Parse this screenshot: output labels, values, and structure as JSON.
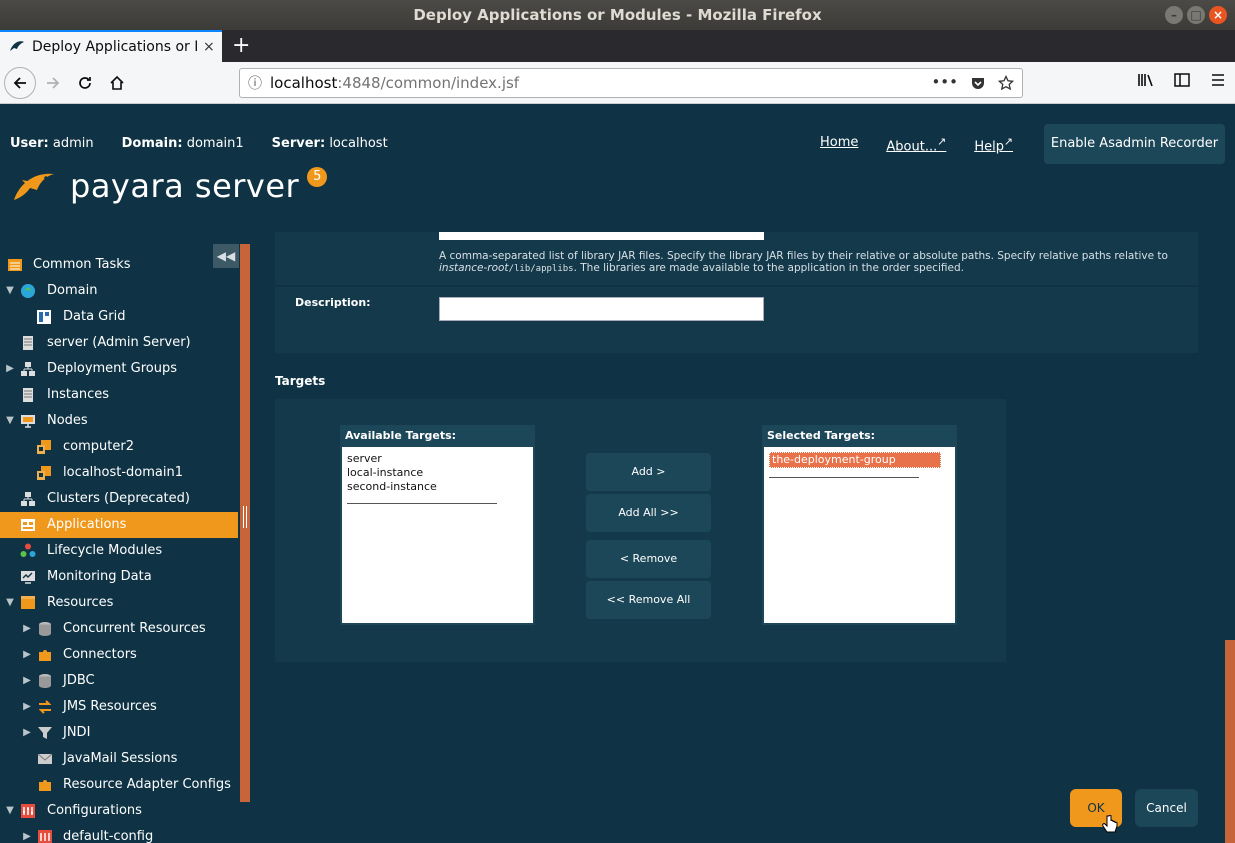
{
  "window": {
    "title": "Deploy Applications or Modules - Mozilla Firefox",
    "controls": [
      "–",
      "□",
      "×"
    ]
  },
  "browser": {
    "tab_title": "Deploy Applications or Modules",
    "tab_close": "×",
    "new_tab": "+",
    "url_host": "localhost",
    "url_rest": ":4848/common/index.jsf",
    "page_actions": "•••"
  },
  "header": {
    "user_label": "User:",
    "user_value": "admin",
    "domain_label": "Domain:",
    "domain_value": "domain1",
    "server_label": "Server:",
    "server_value": "localhost",
    "links": {
      "home": "Home",
      "about": "About...",
      "help": "Help"
    },
    "asadmin_button": "Enable Asadmin Recorder",
    "logo_text": "payara server",
    "logo_version": "5"
  },
  "sidebar": {
    "collapse_icon": "◀◀",
    "items": [
      {
        "label": "Common Tasks"
      },
      {
        "label": "Domain"
      },
      {
        "label": "Data Grid"
      },
      {
        "label": "server (Admin Server)"
      },
      {
        "label": "Deployment Groups"
      },
      {
        "label": "Instances"
      },
      {
        "label": "Nodes"
      },
      {
        "label": "computer2"
      },
      {
        "label": "localhost-domain1"
      },
      {
        "label": "Clusters (Deprecated)"
      },
      {
        "label": "Applications"
      },
      {
        "label": "Lifecycle Modules"
      },
      {
        "label": "Monitoring Data"
      },
      {
        "label": "Resources"
      },
      {
        "label": "Concurrent Resources"
      },
      {
        "label": "Connectors"
      },
      {
        "label": "JDBC"
      },
      {
        "label": "JMS Resources"
      },
      {
        "label": "JNDI"
      },
      {
        "label": "JavaMail Sessions"
      },
      {
        "label": "Resource Adapter Configs"
      },
      {
        "label": "Configurations"
      },
      {
        "label": "default-config"
      }
    ],
    "active_item": "Applications"
  },
  "form": {
    "libraries_help_1": "A comma-separated list of library JAR files. Specify the library JAR files by their relative or absolute paths. Specify relative paths relative to",
    "libraries_help_em": "instance-root",
    "libraries_help_code": "/lib/applibs",
    "libraries_help_2": ". The libraries are made available to the application in the order specified.",
    "description_label": "Description:",
    "description_value": ""
  },
  "targets": {
    "title": "Targets",
    "available_label": "Available Targets:",
    "available": [
      "server",
      "local-instance",
      "second-instance"
    ],
    "selected_label": "Selected Targets:",
    "selected": [
      "the-deployment-group"
    ],
    "add_button": "Add >",
    "add_all_button": "Add All >>",
    "remove_button": "< Remove",
    "remove_all_button": "<< Remove All"
  },
  "actions": {
    "ok_button": "OK",
    "cancel_button": "Cancel"
  },
  "colors": {
    "background": "#0f3344",
    "panel": "#14394b",
    "accent": "#f0981b",
    "button": "#1c4759",
    "scrollbar": "#c8643a"
  }
}
